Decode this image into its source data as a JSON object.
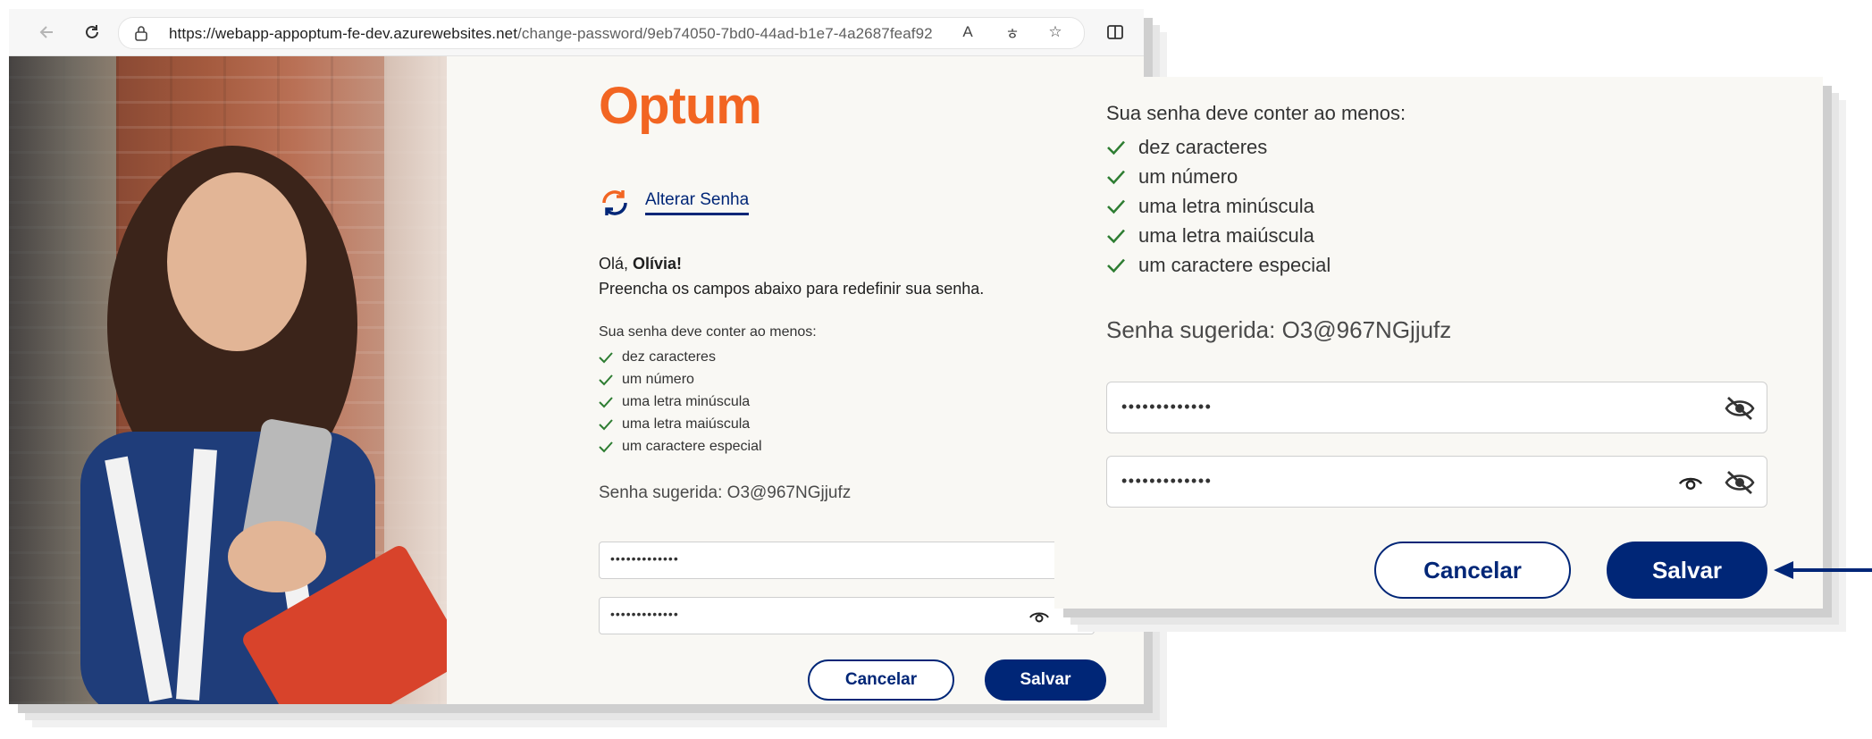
{
  "browser": {
    "url_host": "https://webapp-appoptum-fe-dev.azurewebsites.net",
    "url_path": "/change-password/9eb74050-7bd0-44ad-b1e7-4a2687feaf92"
  },
  "page": {
    "logo": "Optum",
    "section_title": "Alterar Senha",
    "greeting_prefix": "Olá, ",
    "greeting_name": "Olívia!",
    "instruction": "Preencha os campos abaixo para redefinir sua senha.",
    "requirements_title": "Sua senha deve conter ao menos:",
    "requirements": [
      "dez caracteres",
      "um número",
      "uma letra minúscula",
      "uma letra maiúscula",
      "um caractere especial"
    ],
    "suggested_password": "Senha sugerida: O3@967NGjjufz",
    "password_value": "•••••••••••••",
    "confirm_value": "•••••••••••••",
    "cancel_label": "Cancelar",
    "save_label": "Salvar"
  },
  "colors": {
    "brand_orange": "#f26522",
    "brand_navy": "#002677",
    "check_green": "#2e7d32"
  },
  "icons": [
    "back-arrow-icon",
    "refresh-icon",
    "lock-icon",
    "read-aloud-icon",
    "translate-icon",
    "star-icon",
    "split-screen-icon",
    "change-password-icon",
    "check-icon",
    "eye-icon",
    "eye-off-icon",
    "callout-arrow-icon"
  ]
}
